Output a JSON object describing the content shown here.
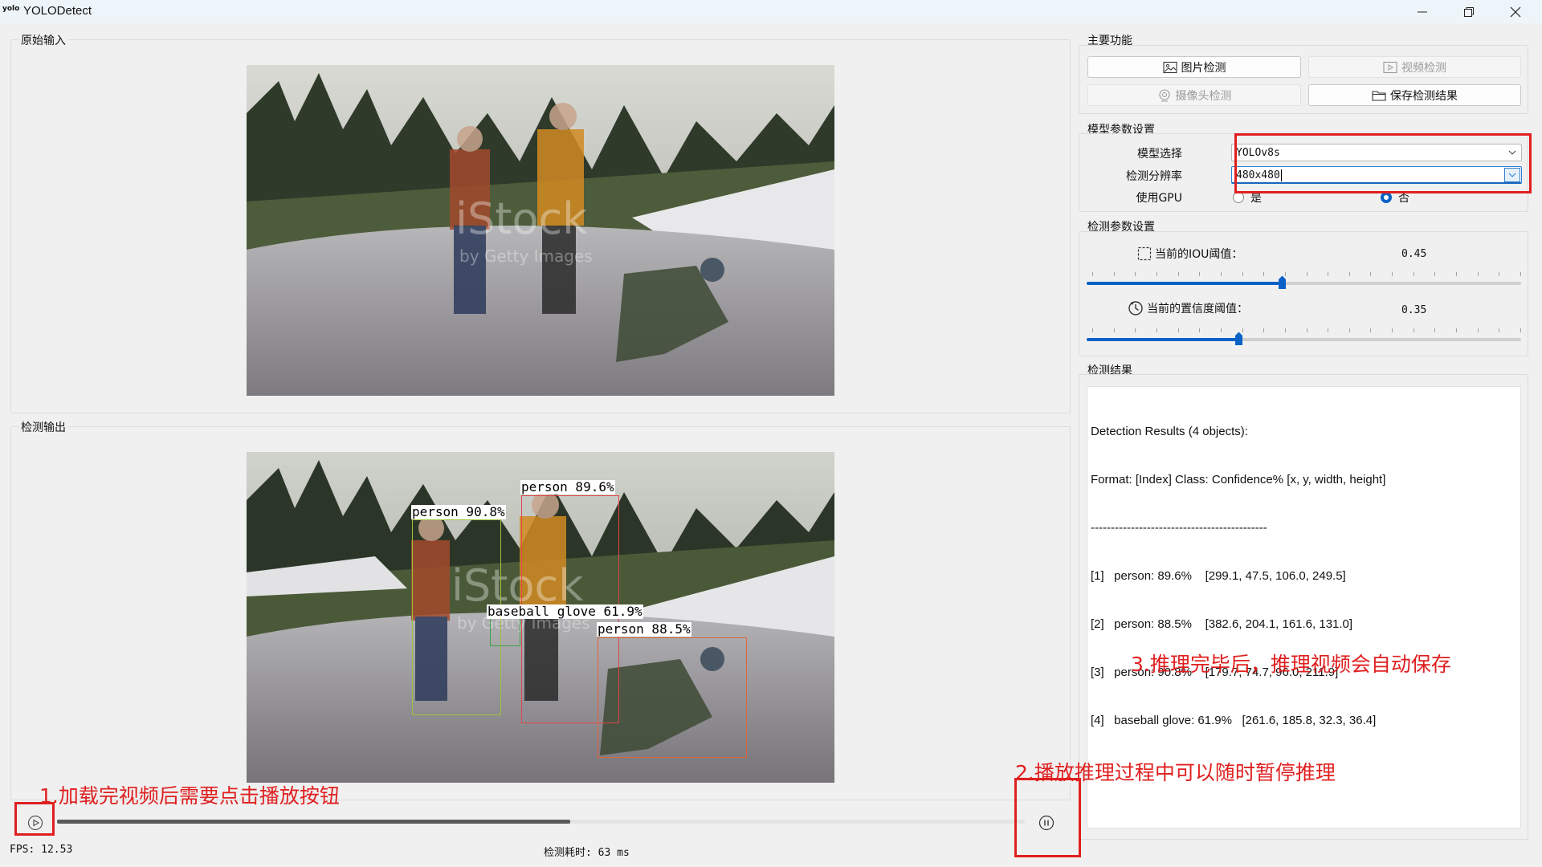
{
  "window": {
    "logo_text": "yolo",
    "title": "YOLODetect"
  },
  "panels": {
    "input_title": "原始输入",
    "output_title": "检测输出"
  },
  "image_watermark": {
    "brand": "iStock",
    "credit": "by Getty Images"
  },
  "detections": [
    {
      "label": "person 90.8%",
      "color": "#9cc33a"
    },
    {
      "label": "person 89.6%",
      "color": "#e0454c"
    },
    {
      "label": "baseball glove 61.9%",
      "color": "#3fa14a"
    },
    {
      "label": "person 88.5%",
      "color": "#e0643a"
    }
  ],
  "main_functions": {
    "title": "主要功能",
    "image_detect": "图片检测",
    "video_detect": "视频检测",
    "camera_detect": "摄像头检测",
    "save_results": "保存检测结果"
  },
  "model_settings": {
    "title": "模型参数设置",
    "model_label": "模型选择",
    "model_value": "YOLOv8s",
    "resolution_label": "检测分辨率",
    "resolution_value": "480x480",
    "gpu_label": "使用GPU",
    "gpu_yes": "是",
    "gpu_no": "否",
    "gpu_selected": "否"
  },
  "detection_settings": {
    "title": "检测参数设置",
    "iou_label": "当前的IOU阈值：",
    "iou_value": "0.45",
    "iou_fraction": 0.45,
    "conf_label": "当前的置信度阈值：",
    "conf_value": "0.35",
    "conf_fraction": 0.35
  },
  "results": {
    "title": "检测结果",
    "lines": [
      "Detection Results (4 objects):",
      "Format: [Index] Class: Confidence% [x, y, width, height]",
      "--------------------------------------------",
      "[1]   person: 89.6%    [299.1, 47.5, 106.0, 249.5]",
      "[2]   person: 88.5%    [382.6, 204.1, 161.6, 131.0]",
      "[3]   person: 90.8%    [179.7, 74.7, 96.0, 211.9]",
      "[4]   baseball glove: 61.9%   [261.6, 185.8, 32.3, 36.4]"
    ]
  },
  "annotations": {
    "step1": "1.加载完视频后需要点击播放按钮",
    "step2": "2.播放推理过程中可以随时暂停推理",
    "step3": "3.推理完毕后，推理视频会自动保存"
  },
  "playback": {
    "progress_fraction": 0.53
  },
  "status": {
    "fps": "FPS: 12.53",
    "time": "检测耗时: 63 ms"
  },
  "colors": {
    "accent": "#0a62c7",
    "annotation": "#e01f1f"
  }
}
